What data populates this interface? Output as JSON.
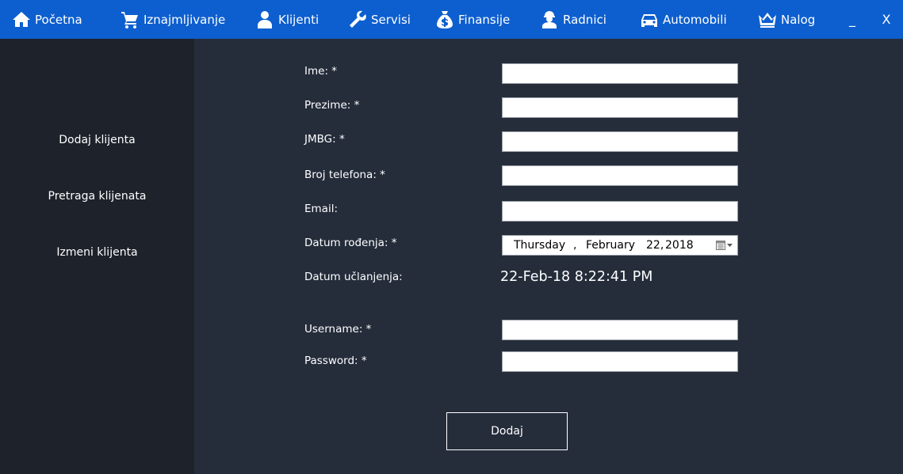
{
  "nav": {
    "items": [
      {
        "label": "Početna",
        "icon": "home-icon"
      },
      {
        "label": "Iznajmljivanje",
        "icon": "cart-icon"
      },
      {
        "label": "Klijenti",
        "icon": "user-icon"
      },
      {
        "label": "Servisi",
        "icon": "wrench-icon"
      },
      {
        "label": "Finansije",
        "icon": "money-bag-icon"
      },
      {
        "label": "Radnici",
        "icon": "worker-icon"
      },
      {
        "label": "Automobili",
        "icon": "car-icon"
      },
      {
        "label": "Nalog",
        "icon": "crown-icon"
      }
    ],
    "minimize": "_",
    "close": "X"
  },
  "sidebar": {
    "items": [
      {
        "label": "Dodaj klijenta"
      },
      {
        "label": "Pretraga klijenata"
      },
      {
        "label": "Izmeni klijenta"
      }
    ]
  },
  "form": {
    "ime_label": "Ime: *",
    "ime_value": "",
    "prezime_label": "Prezime: *",
    "prezime_value": "",
    "jmbg_label": "JMBG: *",
    "jmbg_value": "",
    "telefon_label": "Broj telefona: *",
    "telefon_value": "",
    "email_label": "Email:",
    "email_value": "",
    "datum_rodjenja_label": "Datum rođenja:  *",
    "datum_rodjenja": {
      "weekday": "Thursday",
      "separator": ",",
      "month": "February",
      "day": "22,",
      "year": "2018"
    },
    "datum_uclanjenja_label": "Datum učlanjenja:",
    "datum_uclanjenja_value": "22-Feb-18 8:22:41 PM",
    "username_label": "Username: *",
    "username_value": "",
    "password_label": "Password: *",
    "password_value": "",
    "submit_label": "Dodaj"
  },
  "colors": {
    "topbar": "#0d5fcf",
    "sidebar": "#1d222b",
    "main": "#252d3b",
    "text": "#ffffff"
  }
}
